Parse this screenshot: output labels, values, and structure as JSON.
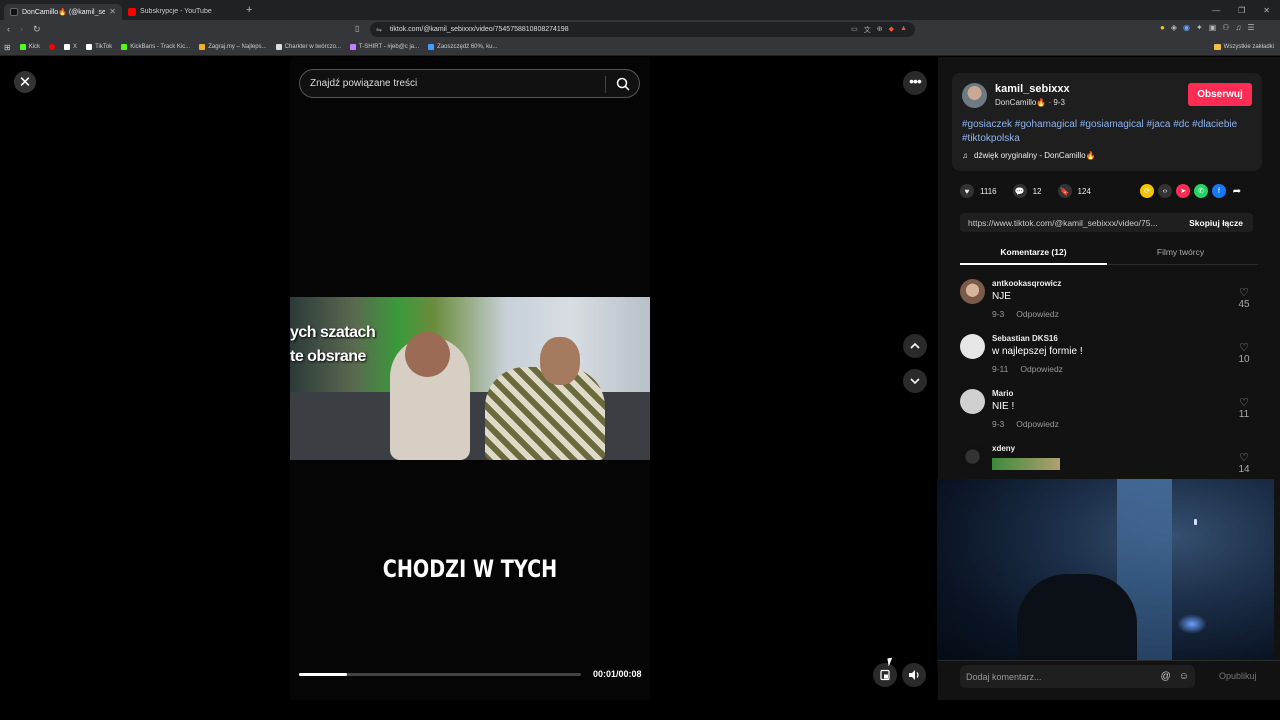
{
  "browser": {
    "tabs": [
      {
        "title": "DonCamillo🔥 (@kamil_sebi...",
        "active": true,
        "color": "#ffffff"
      },
      {
        "title": "Subskrypcje - YouTube",
        "active": false,
        "color": "#ff0000"
      }
    ],
    "url": "tiktok.com/@kamil_sebixxx/video/7545758810808274198",
    "bookmarks": [
      {
        "label": "Kick",
        "color": "#53fc18"
      },
      {
        "label": "",
        "color": "#ff0000"
      },
      {
        "label": "X",
        "color": "#ffffff"
      },
      {
        "label": "TikTok",
        "color": "#ffffff"
      },
      {
        "label": "KickBans - Track Kic...",
        "color": "#53fc18"
      },
      {
        "label": "Zagraj.my – Najleps...",
        "color": "#f0b030"
      },
      {
        "label": "Charkter w twórczo...",
        "color": "#dddddd"
      },
      {
        "label": "T-SHIRT - #jeb@c ja...",
        "color": "#c080ff"
      },
      {
        "label": "Zaoszczędź 60%, ku...",
        "color": "#3fa0ff"
      }
    ],
    "all_bookmarks": "Wszystkie zakładki"
  },
  "video": {
    "search_placeholder": "Znajdź powiązane treści",
    "subtitle": "ych szatach\nte obsrane",
    "caption": "CHODZI W TYCH",
    "time": "00:01/00:08",
    "progress": 0.17
  },
  "panel": {
    "username": "kamil_sebixxx",
    "meta": "DonCamillo🔥 · 9-3",
    "follow_label": "Obserwuj",
    "hashtags": "#gosiaczek #gohamagical #gosiamagical #jaca #dc #dlaciebie #tiktokpolska",
    "sound": "dźwięk oryginalny - DonCamillo🔥",
    "likes": "1116",
    "comments_count": "12",
    "saves": "124",
    "link": "https://www.tiktok.com/@kamil_sebixxx/video/75...",
    "copy_label": "Skopiuj łącze",
    "tab_comments": "Komentarze (12)",
    "tab_creator": "Filmy twórcy",
    "comment_placeholder": "Dodaj komentarz...",
    "publish_label": "Opublikuj"
  },
  "comments": [
    {
      "user": "antkookasqrowicz",
      "text": "NJE",
      "date": "9-3",
      "reply": "Odpowiedz",
      "likes": "45"
    },
    {
      "user": "Sebastian DKS16",
      "text": "w najlepszej formie !",
      "date": "9-11",
      "reply": "Odpowiedz",
      "likes": "10"
    },
    {
      "user": "Mario",
      "text": "NIE !",
      "date": "9-3",
      "reply": "Odpowiedz",
      "likes": "11"
    },
    {
      "user": "xdeny",
      "text": "",
      "date": "",
      "reply": "",
      "likes": "14"
    }
  ]
}
